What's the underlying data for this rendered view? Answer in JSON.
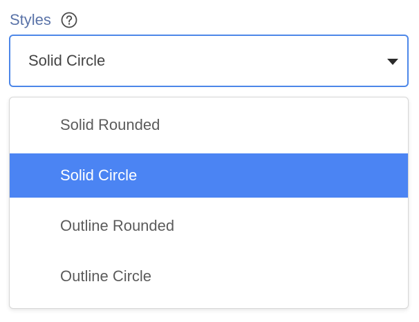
{
  "field": {
    "label": "Styles",
    "help_icon": "question-circle-icon"
  },
  "select": {
    "value": "Solid Circle",
    "caret_icon": "caret-down-icon"
  },
  "dropdown": {
    "options": [
      {
        "label": "Solid Rounded",
        "selected": false
      },
      {
        "label": "Solid Circle",
        "selected": true
      },
      {
        "label": "Outline Rounded",
        "selected": false
      },
      {
        "label": "Outline Circle",
        "selected": false
      }
    ]
  },
  "colors": {
    "label": "#5a73a8",
    "focus_border": "#4c86e8",
    "selected_bg": "#4b84f3",
    "selected_text": "#ffffff",
    "option_text": "#5b5b5b"
  }
}
